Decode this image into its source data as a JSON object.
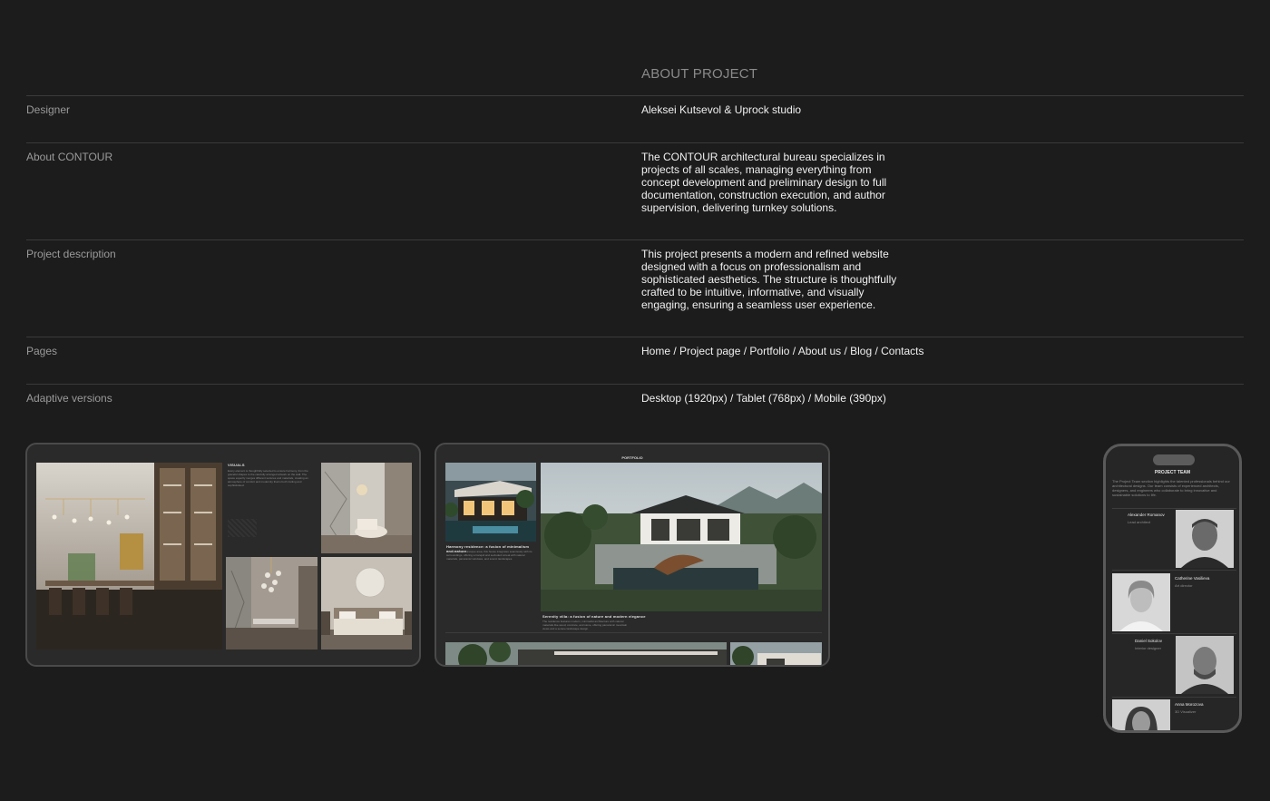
{
  "section_title": "ABOUT PROJECT",
  "rows": [
    {
      "label": "Designer",
      "value": "Aleksei Kutsevol & Uprock studio"
    },
    {
      "label": "About CONTOUR",
      "value": "The CONTOUR architectural bureau specializes in projects of all scales, managing everything from concept development and preliminary design to full documentation, construction execution, and author supervision, delivering turnkey solutions."
    },
    {
      "label": "Project description",
      "value": "This project presents a modern and refined website designed with a focus on professionalism and sophisticated aesthetics. The structure is thoughtfully crafted to be intuitive, informative, and visually engaging, ensuring a seamless user experience."
    },
    {
      "label": "Pages",
      "value": "Home / Project page / Portfolio / About us / Blog / Contacts"
    },
    {
      "label": "Adaptive versions",
      "value": "Desktop (1920px) / Tablet (768px) / Mobile (390px)"
    }
  ],
  "tablet_visuals": {
    "title": "VISUALS",
    "text": "Every element is thoughtfully selected to ensure harmony, from the graceful shapes to the carefully arranged artwork on the wall. The space expertly merges different textures and materials, creating an atmosphere of comfort and modernity that is both inviting and sophisticated."
  },
  "tablet_portfolio": {
    "title": "PORTFOLIO",
    "card1_title": "Harmony residence: a fusion of minimalism and nature",
    "card1_text": "Located in a picturesque area, this house integrates seamlessly with its surroundings, offering a tranquil and secluded retreat with natural materials, panoramic windows, and scenic landscapes.",
    "card2_title": "Serenity villa: a fusion of nature and modern elegance",
    "card2_text": "The residence features modern, minimalist architecture with natural materials like wood, concrete, and stone, offering panoramic mountain views and a serene landscape design."
  },
  "phone": {
    "title": "PROJECT TEAM",
    "intro": "The Project Team section highlights the talented professionals behind our architectural designs. Our team consists of experienced architects, designers, and engineers who collaborate to bring innovative and sustainable solutions to life.",
    "members": [
      {
        "name": "Alexander Romanov",
        "role": "Lead architect"
      },
      {
        "name": "Catherine Vasilieva",
        "role": "Art director"
      },
      {
        "name": "Daniel Sokolov",
        "role": "Interior designer"
      },
      {
        "name": "Anna Morozova",
        "role": "3D Visualizer"
      }
    ]
  },
  "colors": {
    "background": "#1c1c1c",
    "divider": "#3a3a3a",
    "muted": "#9a9a9a",
    "text": "#f0f0f0"
  }
}
